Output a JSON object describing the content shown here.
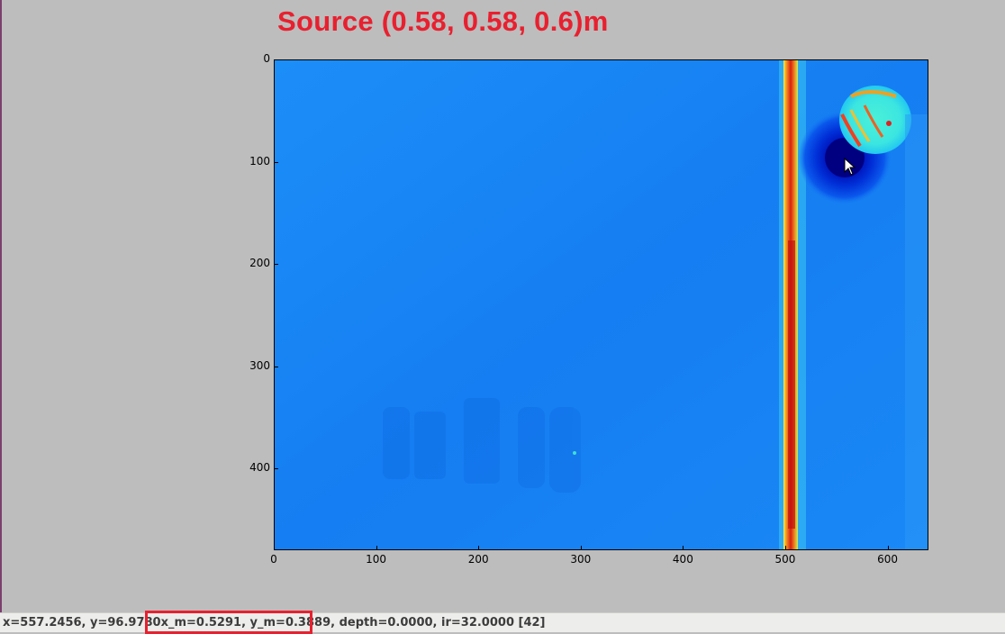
{
  "annotation": {
    "title": "Source (0.58, 0.58, 0.6)m",
    "title_color": "#e8202f"
  },
  "plot": {
    "xaxis_ticks": [
      "0",
      "100",
      "200",
      "300",
      "400",
      "500",
      "600"
    ],
    "yaxis_ticks": [
      "0",
      "100",
      "200",
      "300",
      "400"
    ],
    "xlim": [
      0,
      640
    ],
    "ylim": [
      480,
      0
    ],
    "colormap": "jet",
    "background_color": "#1a84f4"
  },
  "status": {
    "coords": "x=557.2456, y=96.9780",
    "metric": "x_m=0.5291, y_m=0.3889",
    "extra": "depth=0.0000, ir=32.0000 [42]",
    "highlight_color": "#e8202f"
  },
  "cursor": {
    "icon": "mouse-pointer-icon"
  }
}
